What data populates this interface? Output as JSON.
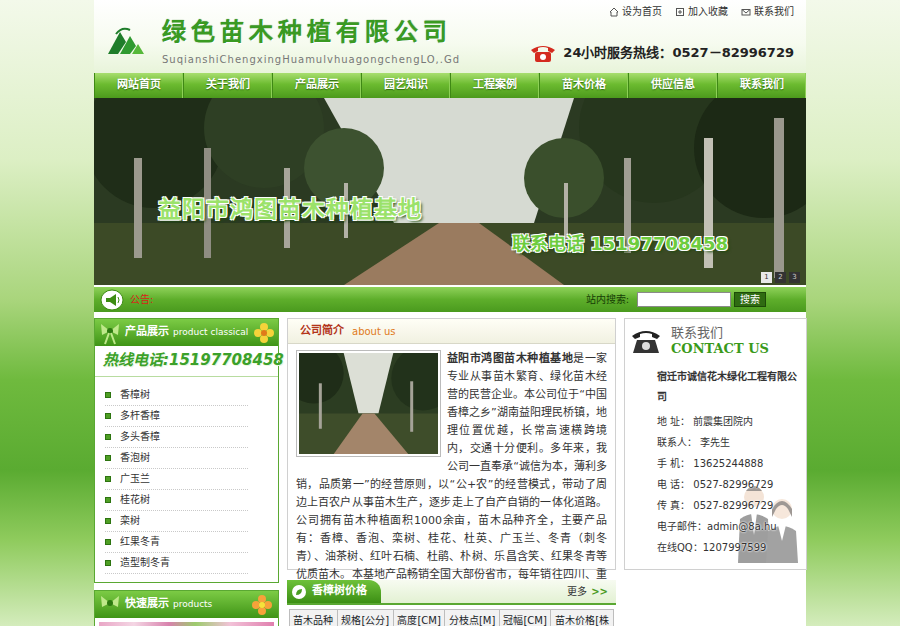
{
  "header": {
    "title": "绿色苗木种植有限公司",
    "subtitle": "SuqianshiChengxingHuamulvhuagongchengLO,.Gd",
    "top_links": [
      "设为首页",
      "加入收藏",
      "联系我们"
    ],
    "hotline": "24小时服务热线：0527－82996729"
  },
  "nav": [
    {
      "label": "网站首页",
      "selected": false
    },
    {
      "label": "关于我们",
      "selected": false
    },
    {
      "label": "产品展示",
      "selected": false
    },
    {
      "label": "园艺知识",
      "selected": false
    },
    {
      "label": "工程案例",
      "selected": false
    },
    {
      "label": "苗木价格",
      "selected": false
    },
    {
      "label": "供应信息",
      "selected": false
    },
    {
      "label": "联系我们",
      "selected": false
    }
  ],
  "banner": {
    "title": "益阳市鸿图苗木种植基地",
    "phone": "联系电话 15197708458",
    "slides": [
      {
        "label": "1",
        "selected": true
      },
      {
        "label": "2",
        "selected": false
      },
      {
        "label": "3",
        "selected": false
      }
    ]
  },
  "notice": {
    "label": "公告:",
    "search_label": "站内搜索:",
    "search_button": "搜索"
  },
  "products": {
    "title": "产品展示",
    "title_en": "product classical",
    "hotline": "热线电话:15197708458",
    "items": [
      "香樟树",
      "多杆香樟",
      "多头香樟",
      "香泡树",
      "广玉兰",
      "桂花树",
      "栾树",
      "红果冬青",
      "造型制冬青"
    ]
  },
  "quick": {
    "title": "快速展示",
    "title_en": "products"
  },
  "about": {
    "title": "公司简介",
    "title_en": "about us",
    "lead": "益阳市鸿图苗木种植基地",
    "text": "是一家专业从事苗木繁育、绿化苗木经营的民营企业。本公司位于“中国香樟之乡”湖南益阳理民桥镇，地理位置优越，长常高速横跨境内，交通十分便利。多年来，我公司一直奉承“诚信为本，薄利多销，品质第一”的经营原则，以“公+农”的经营模式，带动了周边上百农户从事苗木生产，逐步走上了自产自销的一体化道路。 公司拥有苗木种植面积1000余亩，苗木品种齐全，主要产品有：香樟、香泡、栾树、桂花、杜英、广玉兰、冬青（刺冬青）、油茶树、红叶石楠、杜鹃、朴树、乐昌含笑、红果冬青等优质苗木。本基地产品畅销全国大部份省市，每年销往四川、重庆、广东、江苏。"
  },
  "prices": {
    "title": "香樟树价格",
    "more": "更多",
    "more_arrow": ">>",
    "columns": [
      "苗木品种",
      "规格[公分]",
      "高度[CM]",
      "分枝点[M]",
      "冠幅[CM]",
      "苗木价格[株"
    ]
  },
  "contact": {
    "title": "联系我们",
    "title_en": "CONTACT US",
    "company": "宿迁市诚信花木绿化工程有限公司",
    "lines": [
      "地 址： 前震集团院内",
      "联系人： 李先生",
      "手 机： 13625244888",
      "电 话： 0527-82996729",
      "传 真： 0527-82996729",
      "电子邮件：admin@8a.hu",
      "在线QQ：1207997599"
    ]
  }
}
